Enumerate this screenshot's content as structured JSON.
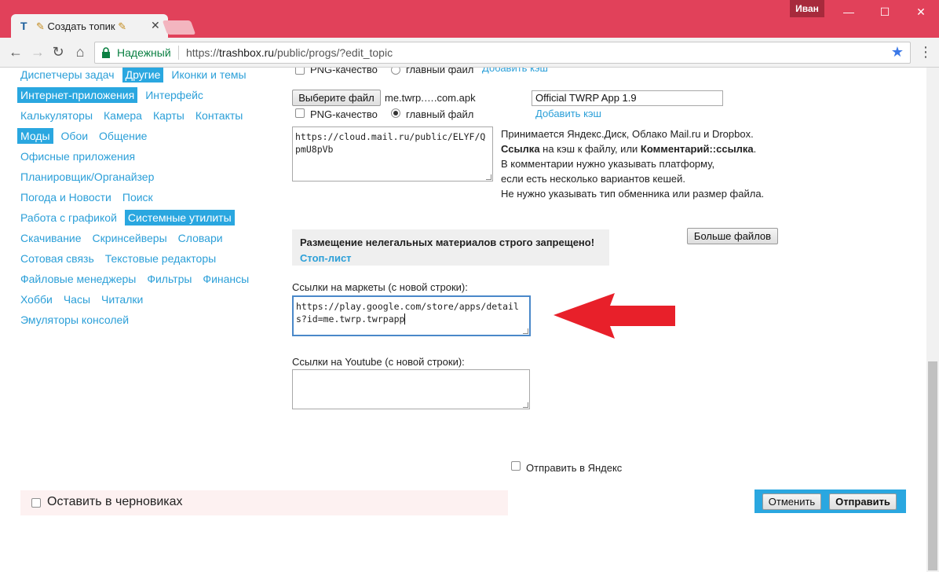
{
  "browser": {
    "tab_title": "Создать топик",
    "favicon": "T",
    "user": "Иван",
    "secure_label": "Надежный",
    "url_scheme": "https://",
    "url_host": "trashbox.ru",
    "url_path": "/public/progs/?edit_topic",
    "accent_color": "#e1415a"
  },
  "categories": [
    {
      "label": "Диспетчеры задач",
      "active": false
    },
    {
      "label": "Другие",
      "active": true
    },
    {
      "label": "Иконки и темы",
      "active": false
    },
    {
      "label": "Интернет-приложения",
      "active": true
    },
    {
      "label": "Интерфейс",
      "active": false
    },
    {
      "label": "Калькуляторы",
      "active": false
    },
    {
      "label": "Камера",
      "active": false
    },
    {
      "label": "Карты",
      "active": false
    },
    {
      "label": "Контакты",
      "active": false
    },
    {
      "label": "Моды",
      "active": true
    },
    {
      "label": "Обои",
      "active": false
    },
    {
      "label": "Общение",
      "active": false
    },
    {
      "label": "Офисные приложения",
      "active": false
    },
    {
      "label": "Планировщик/Органайзер",
      "active": false
    },
    {
      "label": "Погода и Новости",
      "active": false
    },
    {
      "label": "Поиск",
      "active": false
    },
    {
      "label": "Работа с графикой",
      "active": false
    },
    {
      "label": "Системные утилиты",
      "active": true
    },
    {
      "label": "Скачивание",
      "active": false
    },
    {
      "label": "Скринсейверы",
      "active": false
    },
    {
      "label": "Словари",
      "active": false
    },
    {
      "label": "Сотовая связь",
      "active": false
    },
    {
      "label": "Текстовые редакторы",
      "active": false
    },
    {
      "label": "Файловые менеджеры",
      "active": false
    },
    {
      "label": "Фильтры",
      "active": false
    },
    {
      "label": "Финансы",
      "active": false
    },
    {
      "label": "Хобби",
      "active": false
    },
    {
      "label": "Часы",
      "active": false
    },
    {
      "label": "Читалки",
      "active": false
    },
    {
      "label": "Эмуляторы консолей",
      "active": false
    }
  ],
  "file_upload": {
    "png_quality_label": "PNG-качество",
    "main_file_label": "главный файл",
    "add_cache_label": "Добавить кэш",
    "choose_file_label": "Выберите файл",
    "file_name": "me.twrp.….com.apk",
    "file_title": "Official TWRP App 1.9",
    "main_file_selected": true,
    "cache_link_value": "https://cloud.mail.ru/public/ELYF/QpmU8pVb"
  },
  "cache_hint": {
    "line1": "Принимается Яндекс.Диск, Облако Mail.ru и Dropbox.",
    "line2_b1": "Ссылка",
    "line2_t1": " на кэш к файлу, или ",
    "line2_b2": "Комментарий::ссылка",
    "line2_t2": ".",
    "line3": "В комментарии нужно указывать платформу,",
    "line4": "если есть несколько вариантов кешей.",
    "line5": "Не нужно указывать тип обменника или размер файла."
  },
  "warning": {
    "text": "Размещение нелегальных материалов строго запрещено!",
    "link": "Стоп-лист"
  },
  "more_files_label": "Больше файлов",
  "markets": {
    "label": "Ссылки на маркеты (с новой строки):",
    "value": "https://play.google.com/store/apps/details?id=me.twrp.twrpapp"
  },
  "youtube": {
    "label": "Ссылки на Youtube (с новой строки):",
    "value": ""
  },
  "send_yandex_label": "Отправить в Яндекс",
  "draft_label": "Оставить в черновиках",
  "cancel_label": "Отменить",
  "submit_label": "Отправить"
}
